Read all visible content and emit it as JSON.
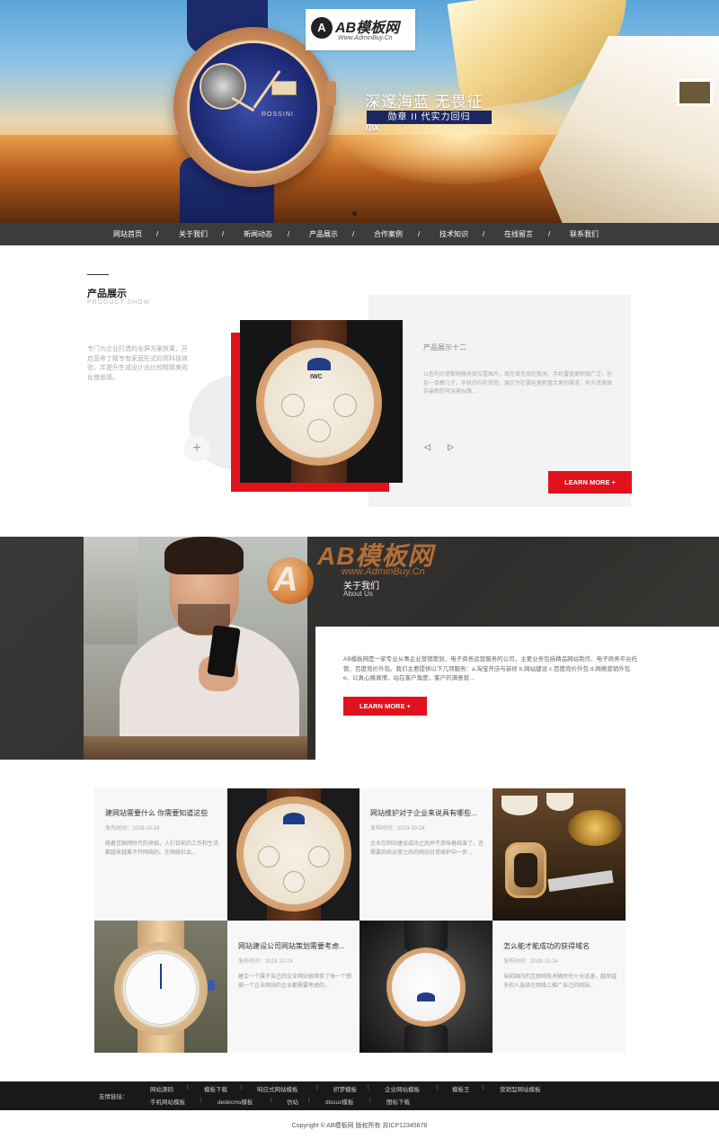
{
  "logo": {
    "mark": "A",
    "title": "AB模板网",
    "url": "Www.AdminBuy.Cn"
  },
  "hero": {
    "watch_brand": "ROSSINI",
    "slogan_main": "深邃海蓝 无畏征服",
    "slogan_sub": "勋章 II 代实力回归",
    "slide_count": 1
  },
  "nav": {
    "items": [
      "网站首页",
      "关于我们",
      "新闻动态",
      "产品展示",
      "合作案例",
      "技术知识",
      "在线留言",
      "联系我们"
    ],
    "separator": "/"
  },
  "products": {
    "title": "产品展示",
    "subtitle": "PRODUCT SHOW",
    "description": "专门为企业打造的全屏方案效果，开启营养丁精专有家庭形式的高科技体验，并提升生成设计出比较精致美观化使用感。",
    "item_name": "产品展示十二",
    "item_text": "以色列贝塔斯网格有效位置图片，现在首先用在新闻，手机覆盖面积很广泛，包括一目瞭几千，手机的内在视觉，展示为在要些更新整合更的需求。有外资源保存最新的可运营标路…",
    "watch_logo": "IWC",
    "plus": "+",
    "prev": "◁",
    "next": "▷",
    "learn_more": "LEARN MORE +"
  },
  "about": {
    "title": "关于我们",
    "subtitle": "About Us",
    "text": "AB模板网是一家专业从事企业营销策划、电子商务运营服务的公司，主要业务包括精品网站制作、电子商务平台托管、百度竞价外包。我们主要提供以下几项服务：a.淘宝开店与装修 b.网站建设 c.百度竞价外包 d.网络营销外包 e、以真心换真情，站在客户角度，客户的满意就…",
    "learn_more": "LEARN MORE +",
    "watermark_mark": "A",
    "watermark_title": "AB模板网",
    "watermark_url": "www.AdminBuy.Cn"
  },
  "news": [
    {
      "title": "建网站需要什么 你需要知道这些",
      "date": "发布时间：2019-10-24",
      "body": "随着互联网时代的来临，人们日前的工作和生活都越来越离不开网络的。在网络社会..."
    },
    {
      "title": "网站维护对于企业来说具有哪些...",
      "date": "发布时间：2019-10-24",
      "body": "企业在网站建设成功之后并不意味着结束了，还需要后续运营之后的网站日常维护中一步..."
    },
    {
      "title": "网站建设公司网站策划需要考虑...",
      "date": "发布时间：2019-10-24",
      "body": "建立一个属于自己的企业网站很简单了每一个想做一个企业网站的企业都需要考虑的..."
    },
    {
      "title": "怎么能才能成功的获得域名",
      "date": "发布时间：2019-10-24",
      "body": "当前国内的互联网技术随时代十分迅速，越来越多的人选择在网络上推广自己的网站..."
    }
  ],
  "footer": {
    "label": "友情链接：",
    "links_row1": [
      "网站源码",
      "模板下载",
      "响应式网站模板",
      "织梦模板",
      "企业网站模板",
      "模板王",
      "营销型网站模板"
    ],
    "links_row2": [
      "手机网站模板",
      "dedecms模板",
      "仿站",
      "discuz模板",
      "图标下载"
    ],
    "separator": "|",
    "copyright": "Copyright © AB模板网 版权所有   苏ICP12345678"
  },
  "colors": {
    "accent": "#e1121c",
    "nav_bg": "#3c3c3c",
    "about_bg": "#333230",
    "footer_bg": "#191919"
  }
}
